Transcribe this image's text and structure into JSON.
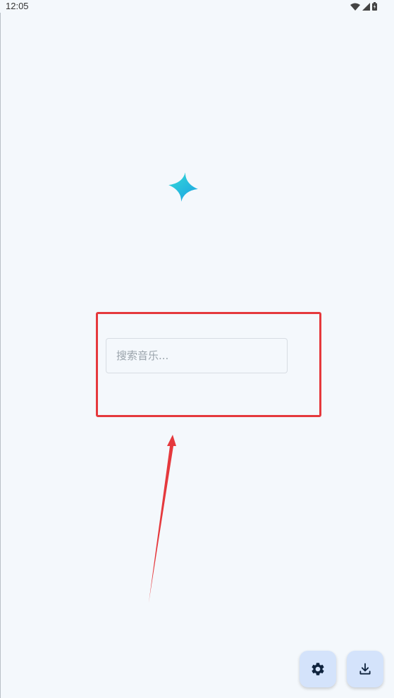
{
  "status_bar": {
    "time": "12:05",
    "icons": [
      "wifi-icon",
      "signal-icon",
      "battery-icon"
    ]
  },
  "logo": {
    "icon": "sparkle-star-icon",
    "gradient": [
      "#2ad4dc",
      "#1a9fe3"
    ]
  },
  "search": {
    "placeholder": "搜索音乐...",
    "value": ""
  },
  "actions": {
    "settings_icon": "gear-icon",
    "download_icon": "download-icon"
  },
  "colors": {
    "background": "#f4f8fc",
    "fab_background": "#d4e3fb",
    "fab_icon": "#10243e",
    "annotation": "#e5393d"
  }
}
